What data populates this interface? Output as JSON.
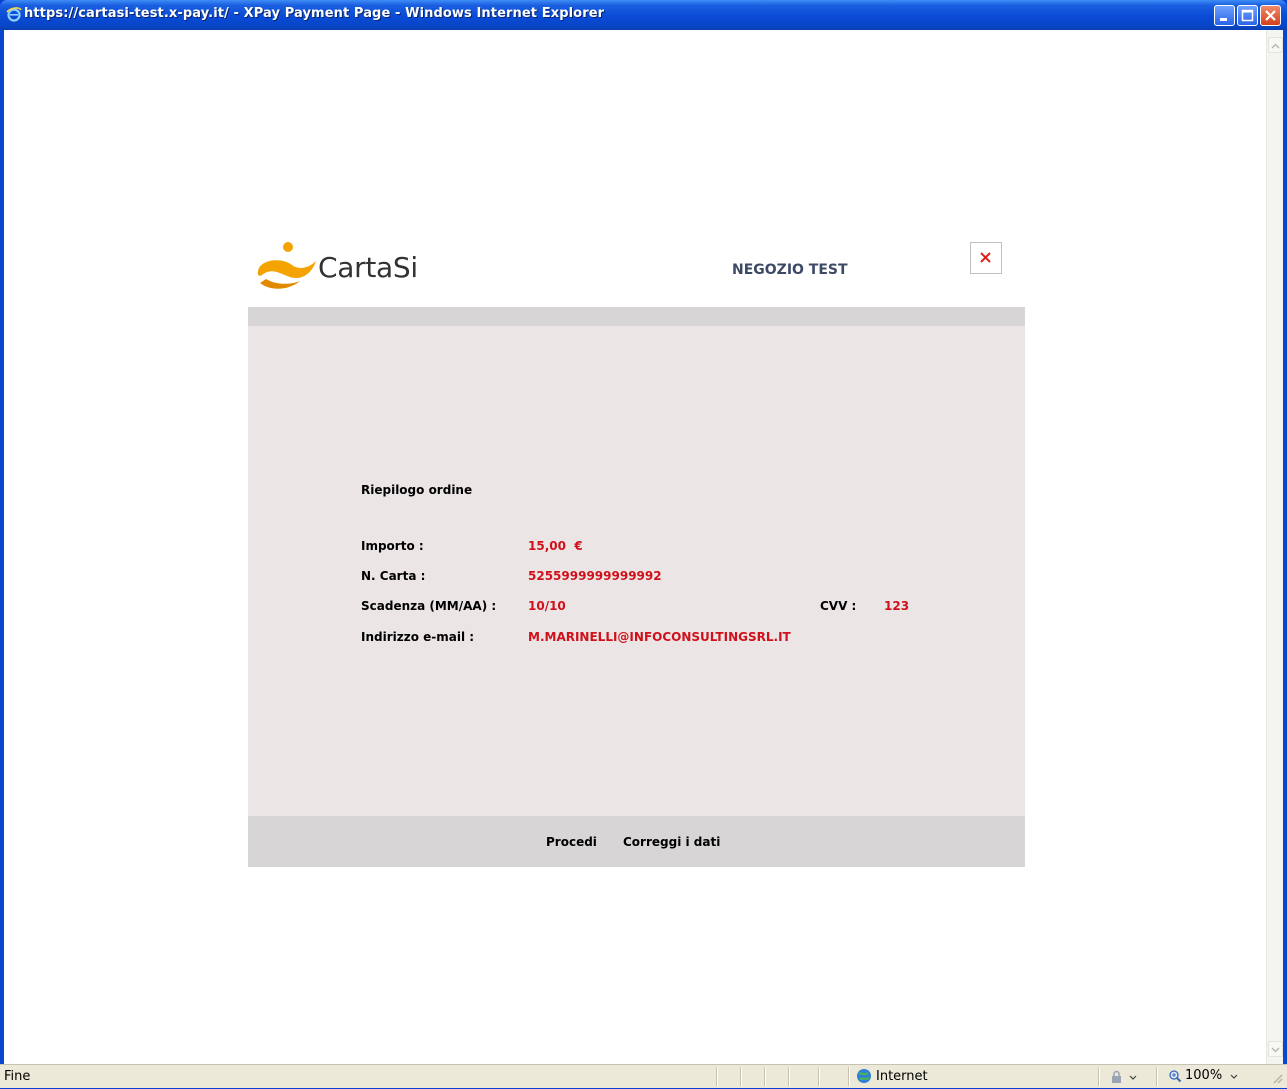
{
  "window": {
    "title": "https://cartasi-test.x-pay.it/ - XPay Payment Page - Windows Internet Explorer",
    "icons": {
      "app": "ie-icon",
      "minimize": "minimize-icon",
      "maximize": "maximize-icon",
      "close": "close-icon"
    }
  },
  "header": {
    "logo_text": "CartaSi",
    "shop_name": "NEGOZIO TEST"
  },
  "summary": {
    "title": "Riepilogo ordine",
    "amount_label": "Importo :",
    "amount_value": "15,00  €",
    "card_label": "N. Carta :",
    "card_value": "5255999999999992",
    "expiry_label": "Scadenza (MM/AA) :",
    "expiry_value": "10/10",
    "cvv_label": "CVV :",
    "cvv_value": "123",
    "email_label": "Indirizzo e-mail :",
    "email_value": "M.MARINELLI@INFOCONSULTINGSRL.IT"
  },
  "actions": {
    "proceed": "Procedi",
    "correct": "Correggi i dati"
  },
  "statusbar": {
    "text": "Fine",
    "zone": "Internet",
    "zoom": "100%"
  },
  "colors": {
    "value_red": "#d0101a",
    "panel": "#ebe5e5",
    "panel_band": "#d7d5d5",
    "logo_orange": "#f5a300"
  }
}
